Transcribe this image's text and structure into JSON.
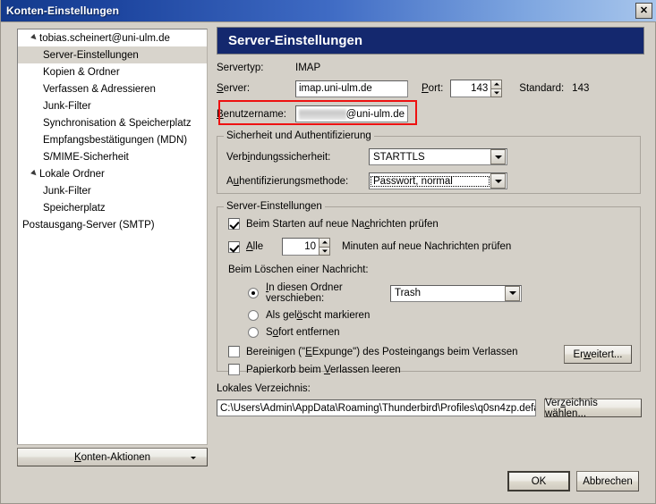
{
  "window": {
    "title": "Konten-Einstellungen",
    "close_label": "✕"
  },
  "sidebar": {
    "items": [
      {
        "label": "tobias.scheinert@uni-ulm.de",
        "level": "root",
        "twisty": true,
        "selected": false
      },
      {
        "label": "Server-Einstellungen",
        "level": "child",
        "twisty": false,
        "selected": true
      },
      {
        "label": "Kopien & Ordner",
        "level": "child",
        "twisty": false,
        "selected": false
      },
      {
        "label": "Verfassen & Adressieren",
        "level": "child",
        "twisty": false,
        "selected": false
      },
      {
        "label": "Junk-Filter",
        "level": "child",
        "twisty": false,
        "selected": false
      },
      {
        "label": "Synchronisation & Speicherplatz",
        "level": "child",
        "twisty": false,
        "selected": false
      },
      {
        "label": "Empfangsbestätigungen (MDN)",
        "level": "child",
        "twisty": false,
        "selected": false
      },
      {
        "label": "S/MIME-Sicherheit",
        "level": "child",
        "twisty": false,
        "selected": false
      },
      {
        "label": "Lokale Ordner",
        "level": "root",
        "twisty": true,
        "selected": false
      },
      {
        "label": "Junk-Filter",
        "level": "child",
        "twisty": false,
        "selected": false
      },
      {
        "label": "Speicherplatz",
        "level": "child",
        "twisty": false,
        "selected": false
      },
      {
        "label": "Postausgang-Server (SMTP)",
        "level": "smtp",
        "twisty": false,
        "selected": false
      }
    ],
    "actions_button": "Konten-Aktionen"
  },
  "panel": {
    "header": "Server-Einstellungen",
    "servertype_label": "Servertyp:",
    "servertype_value": "IMAP",
    "server_label": "Server:",
    "server_value": "imap.uni-ulm.de",
    "port_label": "Port:",
    "port_value": "143",
    "standard_label": "Standard:",
    "standard_value": "143",
    "username_label": "Benutzername:",
    "username_value": "@uni-ulm.de",
    "username_redacted": true
  },
  "security_group": {
    "title": "Sicherheit und Authentifizierung",
    "connection_label": "Verbindungssicherheit:",
    "connection_value": "STARTTLS",
    "auth_label": "Authentifizierungsmethode:",
    "auth_value": "Passwort, normal"
  },
  "server_group": {
    "title": "Server-Einstellungen",
    "check_on_startup": {
      "label": "Beim Starten auf neue Nachrichten prüfen",
      "checked": true
    },
    "check_interval": {
      "prefix_label": "Alle",
      "value": "10",
      "suffix_label": "Minuten auf neue Nachrichten prüfen",
      "checked": true
    },
    "delete_heading": "Beim Löschen einer Nachricht:",
    "delete_options": [
      {
        "label": "In diesen Ordner verschieben:",
        "selected": true
      },
      {
        "label": "Als gelöscht markieren",
        "selected": false
      },
      {
        "label": "Sofort entfernen",
        "selected": false
      }
    ],
    "trash_folder": "Trash",
    "expunge": {
      "label": "Bereinigen (\"Expunge\") des Posteingangs beim Verlassen",
      "checked": false
    },
    "empty_trash": {
      "label": "Papierkorb beim Verlassen leeren",
      "checked": false
    },
    "advanced_button": "Erweitert..."
  },
  "local_dir": {
    "label": "Lokales Verzeichnis:",
    "value": "C:\\Users\\Admin\\AppData\\Roaming\\Thunderbird\\Profiles\\q0sn4zp.defa",
    "browse_button": "Verzeichnis wählen..."
  },
  "footer": {
    "ok_button": "OK",
    "cancel_button": "Abbrechen"
  },
  "annotation": {
    "highlight_color": "#ee1111",
    "target": "username-field"
  }
}
